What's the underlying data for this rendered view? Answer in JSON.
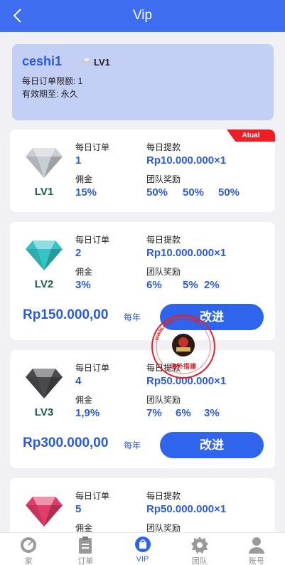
{
  "header": {
    "title": "Vip"
  },
  "user": {
    "name": "ceshi1",
    "level": "LV1",
    "daily_limit": "每日订单限额: 1",
    "valid_until": "有效期至: 永久"
  },
  "labels": {
    "daily_orders": "每日订单",
    "daily_withdraw": "每日提款",
    "commission": "佣金",
    "team_bonus": "团队奖励",
    "per_year": "每年",
    "upgrade": "改进",
    "current_badge": "Atual"
  },
  "levels": [
    {
      "name": "LV1",
      "orders": "1",
      "withdraw": "Rp10.000.000×1",
      "commission": "15%",
      "bonus": [
        "50%",
        "50%",
        "50%"
      ],
      "gem_color": "#c9cdd4"
    },
    {
      "name": "LV2",
      "orders": "2",
      "withdraw": "Rp10.000.000×1",
      "commission": "3%",
      "bonus": [
        "6%",
        "5%",
        "2%"
      ],
      "price": "Rp150.000,00",
      "gem_color": "#35c4c6"
    },
    {
      "name": "LV3",
      "orders": "4",
      "withdraw": "Rp50.000.000×1",
      "commission": "1,9%",
      "bonus": [
        "7%",
        "6%",
        "3%"
      ],
      "price": "Rp300.000,00",
      "gem_color": "#4a4a4e"
    },
    {
      "name": "LV4",
      "orders": "5",
      "withdraw": "Rp50.000.000×1",
      "gem_color": "#e23c6a"
    }
  ],
  "stamp": {
    "text": "www.mkb1777.com",
    "caption": "海外搭建"
  },
  "tabs": [
    {
      "label": "家",
      "icon": "home-dial-icon"
    },
    {
      "label": "订单",
      "icon": "clipboard-icon"
    },
    {
      "label": "VIP",
      "icon": "vip-bag-icon"
    },
    {
      "label": "团队",
      "icon": "gear-icon"
    },
    {
      "label": "账号",
      "icon": "user-icon"
    }
  ],
  "colors": {
    "primary": "#3f6df0",
    "accent_text": "#2d5bd7",
    "badge": "#ee1f24",
    "user_card": "#c3cff4"
  }
}
